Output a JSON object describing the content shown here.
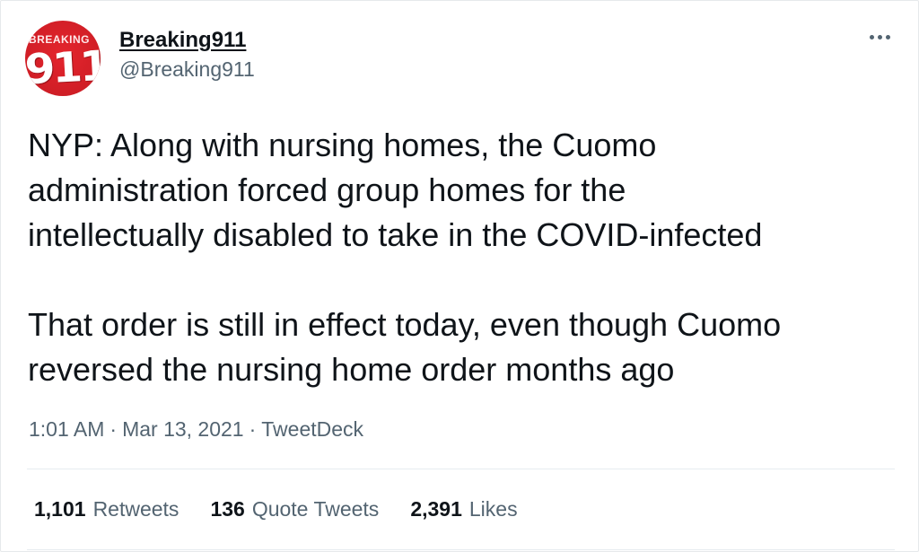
{
  "author": {
    "avatar_text_small": "BREAKING",
    "avatar_text_big": "911",
    "display_name": "Breaking911",
    "handle": "@Breaking911"
  },
  "more_button": {
    "icon": "more-horizontal-icon"
  },
  "tweet": {
    "text": "NYP: Along with nursing homes, the Cuomo\nadministration forced group homes for the\nintellectually disabled to take in the COVID-infected\n\nThat order is still in effect today, even though Cuomo\nreversed the nursing home order months ago",
    "time": "1:01 AM",
    "separator": "·",
    "date": "Mar 13, 2021",
    "source": "TweetDeck"
  },
  "stats": {
    "retweets": {
      "count": "1,101",
      "label": "Retweets"
    },
    "quotes": {
      "count": "136",
      "label": "Quote Tweets"
    },
    "likes": {
      "count": "2,391",
      "label": "Likes"
    }
  },
  "colors": {
    "brand_red": "#d01e26",
    "text_primary": "#0f1419",
    "text_secondary": "#536471",
    "divider": "#e6ecf0"
  }
}
